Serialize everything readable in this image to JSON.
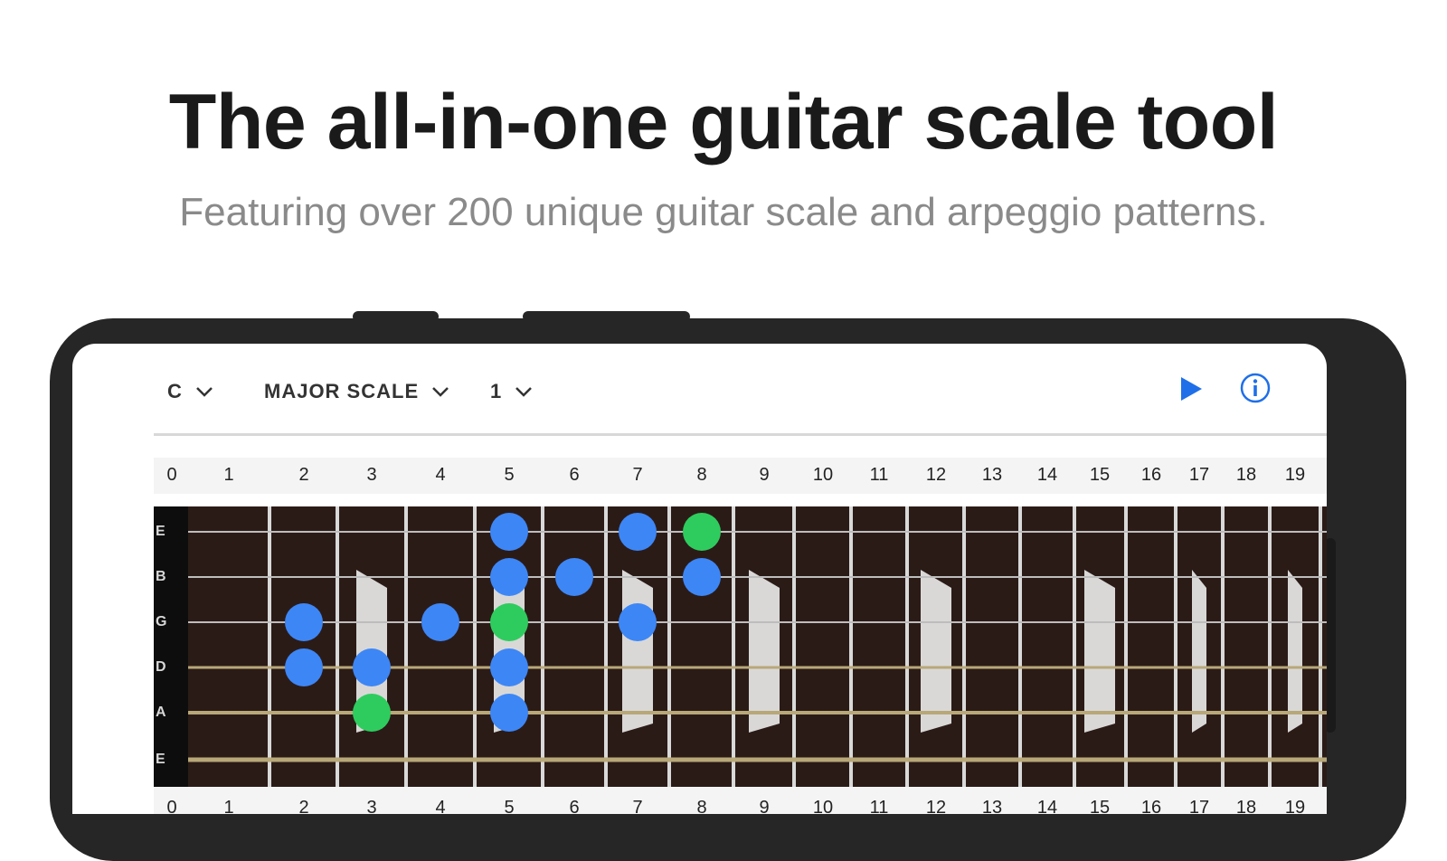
{
  "headline": "The all-in-one guitar scale tool",
  "subheadline": "Featuring over 200 unique guitar scale and arpeggio patterns.",
  "toolbar": {
    "key": "C",
    "scale": "MAJOR SCALE",
    "position": "1",
    "icons": [
      "chevron-down-icon",
      "play-icon",
      "info-icon"
    ]
  },
  "fret_numbers": [
    "0",
    "1",
    "2",
    "3",
    "4",
    "5",
    "6",
    "7",
    "8",
    "9",
    "10",
    "11",
    "12",
    "13",
    "14",
    "15",
    "16",
    "17",
    "18",
    "19"
  ],
  "strings": [
    "E",
    "B",
    "G",
    "D",
    "A",
    "E"
  ],
  "notes": [
    {
      "string": 0,
      "fret": 5,
      "color": "blue"
    },
    {
      "string": 0,
      "fret": 7,
      "color": "blue"
    },
    {
      "string": 0,
      "fret": 8,
      "color": "green"
    },
    {
      "string": 1,
      "fret": 5,
      "color": "blue"
    },
    {
      "string": 1,
      "fret": 6,
      "color": "blue"
    },
    {
      "string": 1,
      "fret": 8,
      "color": "blue"
    },
    {
      "string": 2,
      "fret": 2,
      "color": "blue"
    },
    {
      "string": 2,
      "fret": 4,
      "color": "blue"
    },
    {
      "string": 2,
      "fret": 5,
      "color": "green"
    },
    {
      "string": 2,
      "fret": 7,
      "color": "blue"
    },
    {
      "string": 3,
      "fret": 2,
      "color": "blue"
    },
    {
      "string": 3,
      "fret": 3,
      "color": "blue"
    },
    {
      "string": 3,
      "fret": 5,
      "color": "blue"
    },
    {
      "string": 4,
      "fret": 3,
      "color": "green"
    },
    {
      "string": 4,
      "fret": 5,
      "color": "blue"
    }
  ],
  "inlay_frets": [
    3,
    5,
    7,
    9,
    12,
    15,
    17,
    19
  ],
  "colors": {
    "blue": "#3d86f6",
    "green": "#2ecc5e",
    "fretboard": "#2b1b17",
    "fret": "#d9d9d9",
    "string_plain": "#bdbdbd",
    "string_wound": "#b8a878",
    "accent": "#1f6fe8",
    "phone": "#262626"
  }
}
